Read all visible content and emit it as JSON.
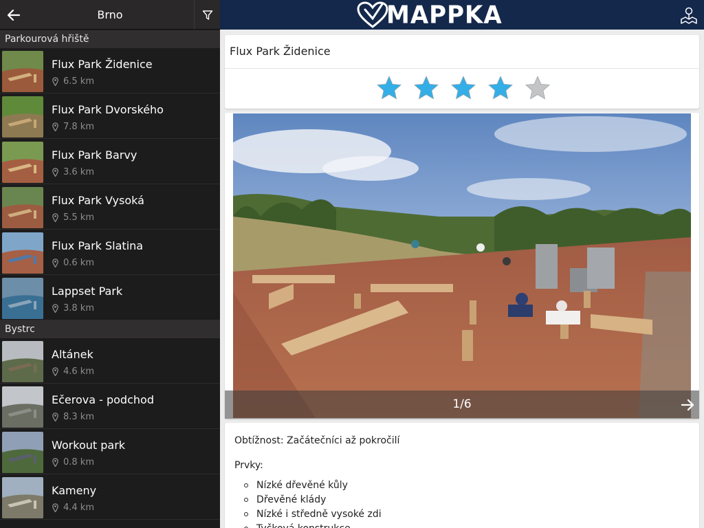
{
  "sidebar": {
    "city": "Brno",
    "sections": [
      {
        "title": "Parkourová hřiště",
        "items": [
          {
            "name": "Flux Park Židenice",
            "distance": "6.5 km"
          },
          {
            "name": "Flux Park Dvorského",
            "distance": "7.8 km"
          },
          {
            "name": "Flux Park Barvy",
            "distance": "3.6 km"
          },
          {
            "name": "Flux Park Vysoká",
            "distance": "5.5 km"
          },
          {
            "name": "Flux Park Slatina",
            "distance": "0.6 km"
          },
          {
            "name": "Lappset Park",
            "distance": "3.8 km"
          }
        ]
      },
      {
        "title": "Bystrc",
        "items": [
          {
            "name": "Altánek",
            "distance": "4.6 km"
          },
          {
            "name": "Ečerova - podchod",
            "distance": "8.3 km"
          },
          {
            "name": "Workout park",
            "distance": "0.8 km"
          },
          {
            "name": "Kameny",
            "distance": "4.4 km"
          }
        ]
      }
    ]
  },
  "topbar": {
    "brand": "MAPPKA",
    "logo_icon": "heart-logo-icon",
    "map_icon": "map-pin-icon",
    "background": "#14284b"
  },
  "detail": {
    "title": "Flux Park Židenice",
    "rating": 4,
    "rating_max": 5,
    "star_color": "#34aee6",
    "star_empty_color": "#c4c4c4",
    "gallery_counter": "1/6",
    "difficulty": "Obtížnost: Začátečníci až pokročilí",
    "features_label": "Prvky:",
    "features": [
      "Nízké dřevěné kůly",
      "Dřevěné klády",
      "Nízké i středně vysoké zdi",
      "Tyčková konstrukce"
    ]
  }
}
